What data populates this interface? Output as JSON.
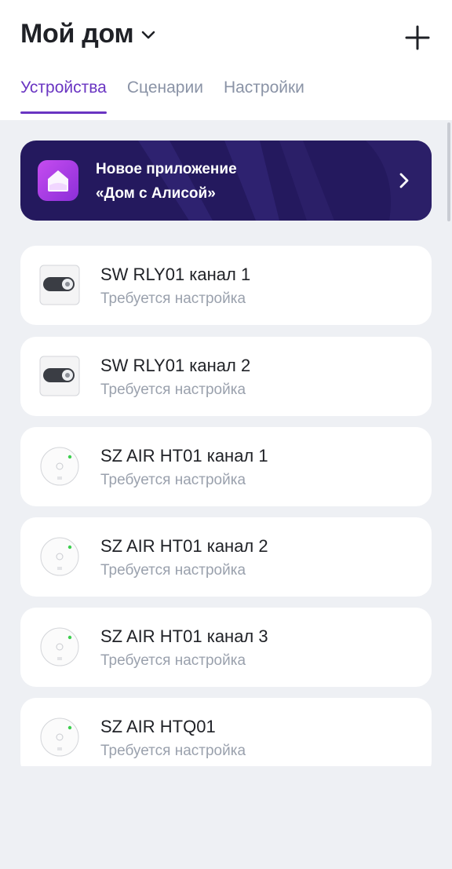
{
  "header": {
    "title": "Мой дом",
    "tabs": [
      {
        "label": "Устройства",
        "active": true
      },
      {
        "label": "Сценарии",
        "active": false
      },
      {
        "label": "Настройки",
        "active": false
      }
    ]
  },
  "banner": {
    "line1": "Новое приложение",
    "line2": "«Дом с Алисой»"
  },
  "devices": [
    {
      "name": "SW RLY01 канал 1",
      "status": "Требуется настройка",
      "icon": "switch-icon"
    },
    {
      "name": "SW RLY01 канал 2",
      "status": "Требуется настройка",
      "icon": "switch-icon"
    },
    {
      "name": "SZ AIR HT01 канал 1",
      "status": "Требуется настройка",
      "icon": "sensor-icon"
    },
    {
      "name": "SZ AIR HT01 канал 2",
      "status": "Требуется настройка",
      "icon": "sensor-icon"
    },
    {
      "name": "SZ AIR HT01 канал 3",
      "status": "Требуется настройка",
      "icon": "sensor-icon"
    },
    {
      "name": "SZ AIR HTQ01",
      "status": "Требуется настройка",
      "icon": "sensor-icon"
    }
  ],
  "colors": {
    "accent": "#6a35c2",
    "banner_bg": "#24195e",
    "background": "#eef0f4"
  }
}
